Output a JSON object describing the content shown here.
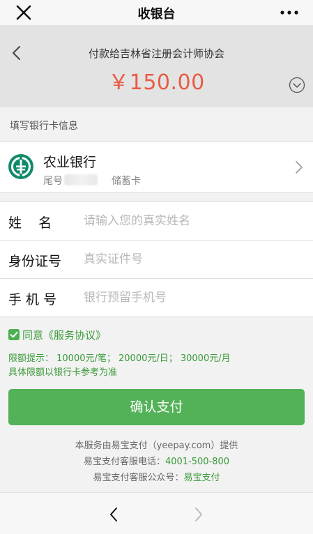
{
  "topbar": {
    "title": "收银台",
    "close_icon": "close-icon",
    "more_icon": "more-dots-icon"
  },
  "payment": {
    "payee": "付款给吉林省注册会计师协会",
    "amount": "￥150.00",
    "amount_color": "#e85b45"
  },
  "section_title": "填写银行卡信息",
  "bank": {
    "name": "农业银行",
    "tail_label": "尾号",
    "card_type": "储蓄卡",
    "logo_color": "#0f8a6a"
  },
  "form": {
    "fields": [
      {
        "label": "姓    名",
        "placeholder": "请输入您的真实姓名",
        "value": ""
      },
      {
        "label": "身份证号",
        "placeholder": "真实证件号",
        "value": ""
      },
      {
        "label": "手 机 号",
        "placeholder": "银行预留手机号",
        "value": ""
      }
    ]
  },
  "agreement": {
    "checked": true,
    "prefix": "同意",
    "link": "《服务协议》"
  },
  "limits": {
    "line1": "限额提示：  10000元/笔；  20000元/日；  30000元/月",
    "line2": "具体限额以银行卡参考为准"
  },
  "confirm_label": "确认支付",
  "accent_color": "#53b257",
  "footer": {
    "line1": "本服务由易宝支付（yeepay.com）提供",
    "line2_prefix": "易宝支付客服电话：",
    "line2_value": "4001-500-800",
    "line3_prefix": "易宝支付客服公众号：",
    "line3_value": "易宝支付"
  }
}
